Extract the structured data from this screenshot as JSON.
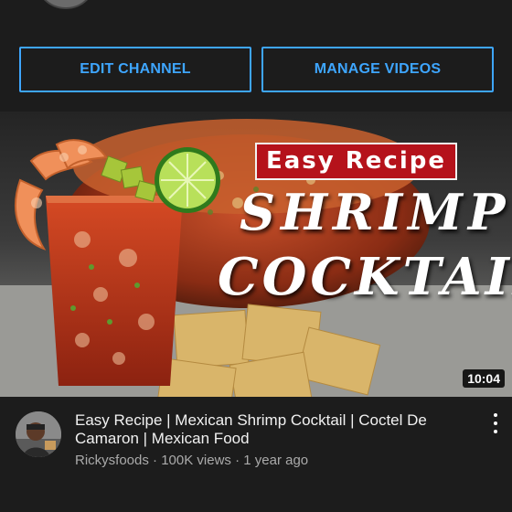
{
  "actions": {
    "edit_channel_label": "EDIT CHANNEL",
    "manage_videos_label": "MANAGE VIDEOS"
  },
  "thumbnail": {
    "badge_text": "Easy Recipe",
    "title_line_1": "SHRIMP",
    "title_line_2": "COCKTAIL",
    "duration": "10:04"
  },
  "video": {
    "title": "Easy Recipe | Mexican Shrimp Cocktail | Coctel De Camaron | Mexican Food",
    "channel": "Rickysfoods",
    "views": "100K views",
    "age": "1 year ago",
    "separator": "·"
  },
  "colors": {
    "accent": "#3ea6ff",
    "background": "#1c1c1c",
    "badge_red": "#b5121b"
  }
}
